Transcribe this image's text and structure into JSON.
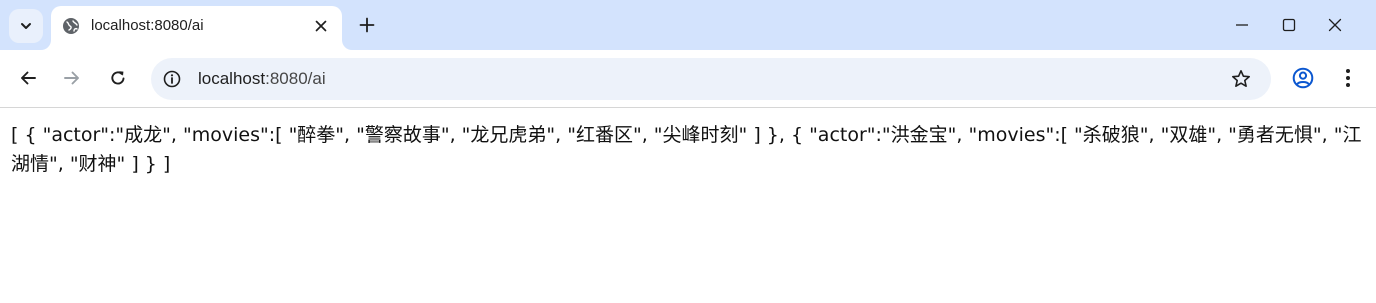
{
  "browser": {
    "tab": {
      "title": "localhost:8080/ai"
    },
    "address_bar": {
      "host": "localhost",
      "rest": ":8080/ai"
    },
    "colors": {
      "tabstrip_bg": "#d3e3fd",
      "omnibox_bg": "#edf2fa",
      "profile_accent": "#0b57d0"
    },
    "icons": {
      "tab_search": "chevron-down-icon",
      "favicon": "globe-icon",
      "tab_close": "close-icon",
      "new_tab": "plus-icon",
      "minimize": "minimize-icon",
      "maximize": "maximize-icon",
      "close_window": "close-window-icon",
      "back": "back-arrow-icon",
      "forward": "forward-arrow-icon",
      "reload": "reload-icon",
      "site_info": "site-info-icon",
      "bookmark": "star-icon",
      "profile": "profile-icon",
      "menu": "kebab-menu-icon"
    }
  },
  "page": {
    "body_text": "[ { \"actor\":\"成龙\", \"movies\":[ \"醉拳\", \"警察故事\", \"龙兄虎弟\", \"红番区\", \"尖峰时刻\" ] }, { \"actor\":\"洪金宝\", \"movies\":[ \"杀破狼\", \"双雄\", \"勇者无惧\", \"江湖情\", \"财神\" ] } ]"
  }
}
